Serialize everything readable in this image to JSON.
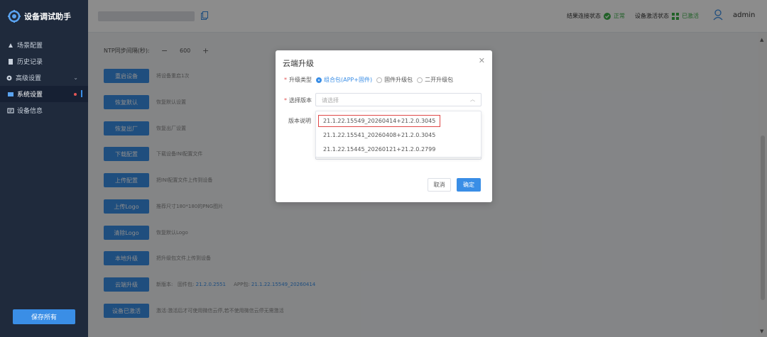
{
  "app": {
    "title": "设备调试助手"
  },
  "sidebar": {
    "items": [
      {
        "label": "场景配置",
        "icon": "scene-icon"
      },
      {
        "label": "历史记录",
        "icon": "history-icon"
      },
      {
        "label": "高级设置",
        "icon": "gear-icon"
      },
      {
        "label": "系统设置",
        "icon": "system-icon"
      },
      {
        "label": "设备信息",
        "icon": "info-icon"
      }
    ],
    "save_all_label": "保存所有"
  },
  "header": {
    "connect_status_label": "结果连接状态",
    "connect_status_value": "正常",
    "activate_status_label": "设备激活状态",
    "activate_status_value": "已激活",
    "username": "admin",
    "colors": {
      "ok": "#3cb14a"
    }
  },
  "content": {
    "ntp_label": "NTP同步间隔(秒):",
    "ntp_value": "600",
    "ops": [
      {
        "button": "重启设备",
        "desc": "将设备重启1次"
      },
      {
        "button": "恢复默认",
        "desc": "恢复默认设置"
      },
      {
        "button": "恢复出厂",
        "desc": "恢复出厂设置"
      },
      {
        "button": "下载配置",
        "desc": "下载设备INI配置文件"
      },
      {
        "button": "上传配置",
        "desc": "把INI配置文件上传到设备"
      },
      {
        "button": "上传Logo",
        "desc": "推荐尺寸180*180的PNG图片"
      },
      {
        "button": "清除Logo",
        "desc": "恢复默认Logo"
      },
      {
        "button": "本地升级",
        "desc": "把升级包文件上传到设备"
      },
      {
        "button": "云端升级",
        "desc_prefix": "新版本:",
        "firmware_label": "固件包:",
        "firmware_value": "21.2.0.2551",
        "app_label": "APP包:",
        "app_value": "21.1.22.15549_20260414"
      },
      {
        "button": "设备已激活",
        "desc": "激活:激活后才可使用微信云停,若不使用微信云停无需激活"
      }
    ]
  },
  "dialog": {
    "title": "云端升级",
    "upgrade_type_label": "升级类型",
    "upgrade_types": [
      "组合包(APP+固件)",
      "固件升级包",
      "二开升级包"
    ],
    "selected_type": "组合包(APP+固件)",
    "version_label": "选择版本",
    "version_placeholder": "请选择",
    "notes_label": "版本说明",
    "version_options": [
      "21.1.22.15549_20260414+21.2.0.3045",
      "21.1.22.15541_20260408+21.2.0.3045",
      "21.1.22.15445_20260121+21.2.0.2799"
    ],
    "cancel_label": "取消",
    "confirm_label": "确定",
    "colors": {
      "accent": "#3a8ee6",
      "highlight": "#e04848"
    }
  }
}
